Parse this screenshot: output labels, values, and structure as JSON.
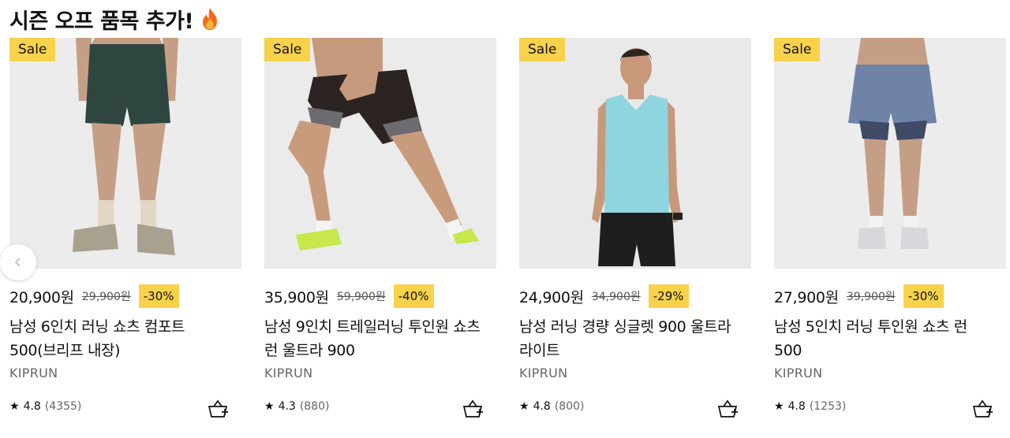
{
  "section": {
    "title": "시즌 오프 품목 추가!",
    "title_icon": "fire-icon"
  },
  "nav": {
    "prev_icon": "chevron-left-icon"
  },
  "colors": {
    "badge": "#f7d24a",
    "text": "#101010",
    "muted": "#666666"
  },
  "products": [
    {
      "badge": "Sale",
      "price": "35,900원",
      "old_price": "59,900원",
      "discount": "-40%",
      "name_line1": "남성 9인치 트레일러닝 투인원 쇼츠",
      "name_line2": "런 울트라 900",
      "brand": "KIPRUN",
      "star": "★",
      "rating": "4.3",
      "reviews": "(880)",
      "cart_icon": "basket-add-icon"
    },
    {
      "badge": "Sale",
      "price": "24,900원",
      "old_price": "34,900원",
      "discount": "-29%",
      "name_line1": "남성 러닝 경량 싱글렛 900 울트라",
      "name_line2": "라이트",
      "brand": "KIPRUN",
      "star": "★",
      "rating": "4.8",
      "reviews": "(800)",
      "cart_icon": "basket-add-icon"
    },
    {
      "badge": "Sale",
      "price": "27,900원",
      "old_price": "39,900원",
      "discount": "-30%",
      "name_line1": "남성 5인치 러닝 투인원 쇼츠 런",
      "name_line2": "500",
      "brand": "KIPRUN",
      "star": "★",
      "rating": "4.8",
      "reviews": "(1253)",
      "cart_icon": "basket-add-icon"
    },
    {
      "badge": "Sale",
      "price": "20,900원",
      "old_price": "29,900원",
      "discount": "-30%",
      "name_line1": "남성 6인치 러닝 쇼츠 컴포트",
      "name_line2": "500(브리프 내장)",
      "brand": "KIPRUN",
      "star": "★",
      "rating": "4.8",
      "reviews": "(4355)",
      "cart_icon": "basket-add-icon"
    }
  ]
}
